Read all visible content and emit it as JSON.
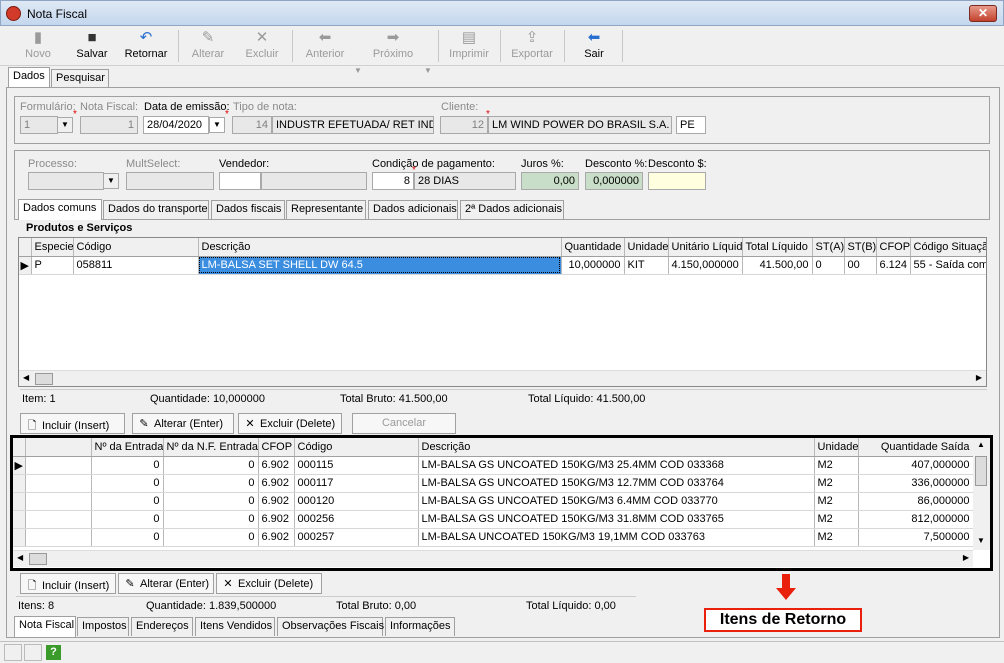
{
  "window": {
    "title": "Nota Fiscal",
    "close": "✕"
  },
  "toolbar": {
    "novo": "Novo",
    "salvar": "Salvar",
    "retornar": "Retornar",
    "alterar": "Alterar",
    "excluir": "Excluir",
    "anterior": "Anterior",
    "proximo": "Próximo",
    "imprimir": "Imprimir",
    "exportar": "Exportar",
    "sair": "Sair"
  },
  "main_tabs": [
    "Dados",
    "Pesquisar"
  ],
  "header": {
    "formulario_label": "Formulário:",
    "formulario_value": "1",
    "nota_fiscal_label": "Nota Fiscal:",
    "nota_fiscal_value": "1",
    "data_emissao_label": "Data de emissão:",
    "data_emissao_value": "28/04/2020",
    "tipo_nota_label": "Tipo de nota:",
    "tipo_nota_code": "14",
    "tipo_nota_desc": "INDUSTR EFETUADA/ RET IND",
    "cliente_label": "Cliente:",
    "cliente_code": "12",
    "cliente_name": "LM WIND POWER DO BRASIL S.A.",
    "cliente_uf": "PE"
  },
  "payment": {
    "processo_label": "Processo:",
    "multselect_label": "MultSelect:",
    "vendedor_label": "Vendedor:",
    "condicao_label": "Condição de pagamento:",
    "condicao_code": "8",
    "condicao_desc": "28 DIAS",
    "juros_label": "Juros %:",
    "juros_value": "0,00",
    "desconto_pct_label": "Desconto %:",
    "desconto_pct_value": "0,000000",
    "desconto_val_label": "Desconto $:",
    "desconto_val_value": ""
  },
  "sub_tabs": [
    "Dados comuns",
    "Dados do transporte",
    "Dados fiscais",
    "Representante",
    "Dados adicionais",
    "2ª Dados adicionais"
  ],
  "produtos": {
    "title": "Produtos e Serviços",
    "columns": [
      "Especie",
      "Código",
      "Descrição",
      "Quantidade",
      "Unidade",
      "Unitário Líquido",
      "Total Líquido",
      "ST(A)",
      "ST(B)",
      "CFOP",
      "Código Situação"
    ],
    "rows": [
      [
        "P",
        "058811",
        "LM-BALSA SET SHELL DW 64.5",
        "10,000000",
        "KIT",
        "4.150,000000",
        "41.500,00",
        "0",
        "00",
        "6.124",
        "55 - Saída com"
      ]
    ],
    "status": {
      "itens": "Item: 1",
      "quantidade": "Quantidade: 10,000000",
      "total_bruto": "Total Bruto: 41.500,00",
      "total_liquido": "Total Líquido: 41.500,00"
    }
  },
  "actions1": {
    "incluir": "Incluir (Insert)",
    "alterar": "Alterar (Enter)",
    "excluir": "Excluir (Delete)",
    "cancelar": "Cancelar"
  },
  "retorno": {
    "columns": [
      "",
      "Nº da Entrada",
      "Nº da N.F. Entrada",
      "CFOP",
      "Código",
      "Descrição",
      "Unidade",
      "Quantidade Saída"
    ],
    "rows": [
      [
        "",
        "0",
        "0",
        "6.902",
        "000115",
        "LM-BALSA GS UNCOATED 150KG/M3 25.4MM COD 033368",
        "M2",
        "407,000000"
      ],
      [
        "",
        "0",
        "0",
        "6.902",
        "000117",
        "LM-BALSA GS UNCOATED 150KG/M3 12.7MM COD 033764",
        "M2",
        "336,000000"
      ],
      [
        "",
        "0",
        "0",
        "6.902",
        "000120",
        "LM-BALSA GS UNCOATED 150KG/M3 6.4MM COD 033770",
        "M2",
        "86,000000"
      ],
      [
        "",
        "0",
        "0",
        "6.902",
        "000256",
        "LM-BALSA GS UNCOATED 150KG/M3 31.8MM COD 033765",
        "M2",
        "812,000000"
      ],
      [
        "",
        "0",
        "0",
        "6.902",
        "000257",
        "LM-BALSA UNCOATED 150KG/M3 19,1MM COD 033763",
        "M2",
        "7,500000"
      ]
    ]
  },
  "actions2": {
    "incluir": "Incluir (Insert)",
    "alterar": "Alterar (Enter)",
    "excluir": "Excluir (Delete)"
  },
  "status2": {
    "itens": "Itens: 8",
    "quantidade": "Quantidade: 1.839,500000",
    "total_bruto": "Total Bruto: 0,00",
    "total_liquido": "Total Líquido: 0,00"
  },
  "bottom_tabs": [
    "Nota Fiscal",
    "Impostos",
    "Endereços",
    "Itens Vendidos",
    "Observações Fiscais",
    "Informações"
  ],
  "annotation": {
    "label": "Itens de Retorno",
    "color": "#e8200c"
  },
  "statusbar": {
    "help": "?"
  }
}
